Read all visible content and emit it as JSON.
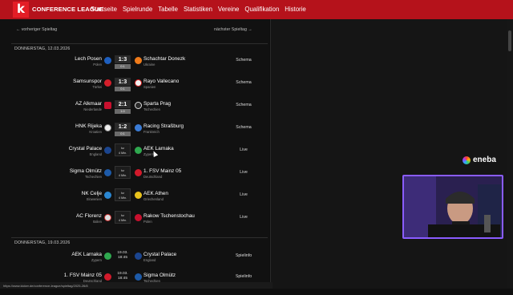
{
  "header": {
    "logo": "k",
    "brand": "CONFERENCE LEAGUE",
    "nav": [
      "Startseite",
      "Spielrunde",
      "Tabelle",
      "Statistiken",
      "Vereine",
      "Qualifikation",
      "Historie"
    ]
  },
  "pager": {
    "prev": "vorheriger Spieltag",
    "next": "nächster Spieltag"
  },
  "sections": [
    {
      "date": "DONNERSTAG, 12.03.2026",
      "matches": [
        {
          "home": "Lech Posen",
          "home_country": "Polen",
          "away": "Schachtar Donezk",
          "away_country": "Ukraine",
          "score": "1:3",
          "sub": "0:1",
          "action": "Schema"
        },
        {
          "home": "Samsunspor",
          "home_country": "Türkei",
          "away": "Rayo Vallecano",
          "away_country": "Spanien",
          "score": "1:3",
          "sub": "0:1",
          "action": "Schema"
        },
        {
          "home": "AZ Alkmaar",
          "home_country": "Niederlande",
          "away": "Sparta Prag",
          "away_country": "Tschechien",
          "score": "2:1",
          "sub": "1:0",
          "action": "Schema"
        },
        {
          "home": "HNK Rijeka",
          "home_country": "Kroatien",
          "away": "Racing Straßburg",
          "away_country": "Frankreich",
          "score": "1:2",
          "sub": "0:1",
          "action": "Schema"
        },
        {
          "home": "Crystal Palace",
          "home_country": "England",
          "away": "AEK Larnaka",
          "away_country": "Zypern",
          "live_line1": "hz",
          "live_line2": "4 Min.",
          "action": "Live"
        },
        {
          "home": "Sigma Olmütz",
          "home_country": "Tschechien",
          "away": "1. FSV Mainz 05",
          "away_country": "Deutschland",
          "live_line1": "hz",
          "live_line2": "4 Min.",
          "action": "Live"
        },
        {
          "home": "NK Celje",
          "home_country": "Slowenien",
          "away": "AEK Athen",
          "away_country": "Griechenland",
          "live_line1": "hz",
          "live_line2": "4 Min.",
          "action": "Live"
        },
        {
          "home": "AC Florenz",
          "home_country": "Italien",
          "away": "Rakow Tschenstochau",
          "away_country": "Polen",
          "live_line1": "hz",
          "live_line2": "4 Min.",
          "action": "Live"
        }
      ]
    },
    {
      "date": "DONNERSTAG, 19.03.2026",
      "matches": [
        {
          "home": "AEK Larnaka",
          "home_country": "Zypern",
          "away": "Crystal Palace",
          "away_country": "England",
          "time_line1": "19.03.",
          "time_line2": "18:45",
          "action": "Spielinfo"
        },
        {
          "home": "1. FSV Mainz 05",
          "home_country": "Deutschland",
          "away": "Sigma Olmütz",
          "away_country": "Tschechien",
          "time_line1": "19.03.",
          "time_line2": "18:45",
          "action": "Spielinfo"
        }
      ]
    }
  ],
  "status_url": "https://www.kicker.de/conference-league/spieltag/2025-26/8",
  "overlay": {
    "sponsor": "eneba"
  },
  "colors": {
    "header": "#b5121b",
    "logo": "#e41d26",
    "webcam_border": "#8a5cff"
  }
}
